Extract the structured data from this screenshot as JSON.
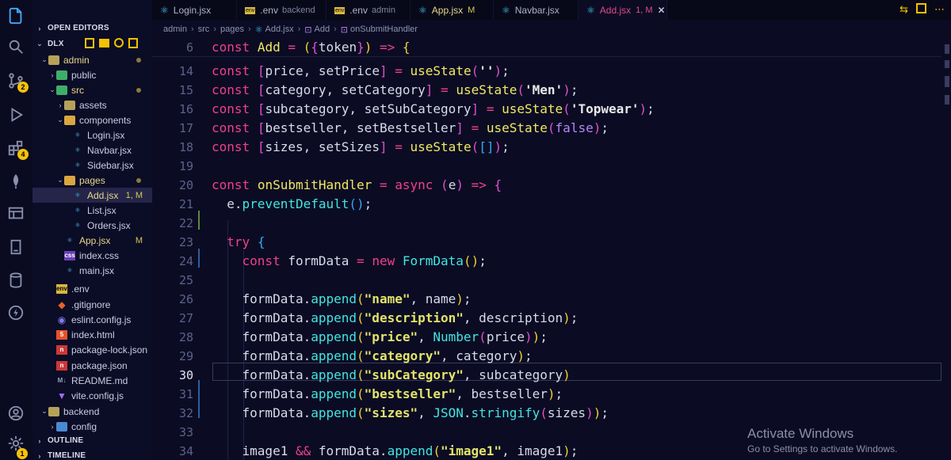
{
  "activity_bar": {
    "icons": [
      "explorer-icon",
      "search-icon",
      "source-control-icon",
      "run-debug-icon",
      "extensions-icon",
      "mongodb-leaf-icon",
      "remote-explorer-icon",
      "notebook-icon",
      "database-icon",
      "lightning-icon",
      "account-icon",
      "settings-gear-icon"
    ],
    "source_control_badge": "2",
    "extensions_badge": "4",
    "settings_badge": "1"
  },
  "sidebar": {
    "open_editors": "OPEN EDITORS",
    "workspace": "DLX",
    "outline": "OUTLINE",
    "timeline": "TIMELINE",
    "tree": [
      {
        "label": "admin",
        "kind": "folder-open"
      },
      {
        "label": "public",
        "kind": "folder"
      },
      {
        "label": "src",
        "kind": "folder-open"
      },
      {
        "label": "assets",
        "kind": "folder"
      },
      {
        "label": "components",
        "kind": "folder-open"
      },
      {
        "label": "Login.jsx",
        "kind": "react"
      },
      {
        "label": "Navbar.jsx",
        "kind": "react"
      },
      {
        "label": "Sidebar.jsx",
        "kind": "react"
      },
      {
        "label": "pages",
        "kind": "folder-open"
      },
      {
        "label": "Add.jsx",
        "kind": "react",
        "status": "1, M"
      },
      {
        "label": "List.jsx",
        "kind": "react"
      },
      {
        "label": "Orders.jsx",
        "kind": "react"
      },
      {
        "label": "App.jsx",
        "kind": "react",
        "status": "M"
      },
      {
        "label": "index.css",
        "kind": "css"
      },
      {
        "label": "main.jsx",
        "kind": "react"
      },
      {
        "label": ".env",
        "kind": "env"
      },
      {
        "label": ".gitignore",
        "kind": "git"
      },
      {
        "label": "eslint.config.js",
        "kind": "eslint"
      },
      {
        "label": "index.html",
        "kind": "html"
      },
      {
        "label": "package-lock.json",
        "kind": "npm"
      },
      {
        "label": "package.json",
        "kind": "npm"
      },
      {
        "label": "README.md",
        "kind": "md"
      },
      {
        "label": "vite.config.js",
        "kind": "vite"
      },
      {
        "label": "backend",
        "kind": "folder-open"
      },
      {
        "label": "config",
        "kind": "folder"
      }
    ]
  },
  "tabs": [
    {
      "label": "Login.jsx",
      "sub": "",
      "mark": ""
    },
    {
      "label": ".env",
      "sub": "backend",
      "mark": ""
    },
    {
      "label": ".env",
      "sub": "admin",
      "mark": ""
    },
    {
      "label": "App.jsx",
      "sub": "",
      "mark": "M"
    },
    {
      "label": "Navbar.jsx",
      "sub": "",
      "mark": ""
    },
    {
      "label": "Add.jsx",
      "sub": "",
      "mark": "1, M"
    }
  ],
  "breadcrumb": [
    "admin",
    "src",
    "pages",
    "Add.jsx",
    "Add",
    "onSubmitHandler"
  ],
  "editor": {
    "sticky_line_number": "6",
    "line_numbers": [
      "14",
      "15",
      "16",
      "17",
      "18",
      "19",
      "20",
      "21",
      "22",
      "23",
      "24",
      "25",
      "26",
      "27",
      "28",
      "29",
      "30",
      "31",
      "32",
      "33",
      "34"
    ],
    "current_line": "30"
  },
  "watermark": {
    "title": "Activate Windows",
    "subtitle": "Go to Settings to activate Windows."
  }
}
